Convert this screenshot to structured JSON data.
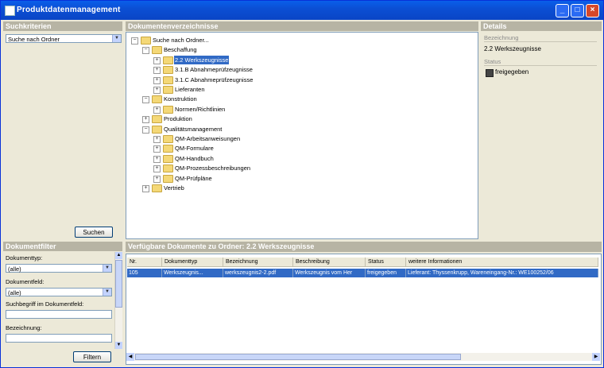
{
  "window": {
    "title": "Produktdatenmanagement"
  },
  "search_panel": {
    "header": "Suchkriterien",
    "combo_value": "Suche nach Ordner",
    "button": "Suchen"
  },
  "tree_panel": {
    "header": "Dokumentenverzeichnisse",
    "nodes": [
      {
        "label": "Suche nach Ordner...",
        "level": 0,
        "expanded": true
      },
      {
        "label": "Beschaffung",
        "level": 1,
        "expanded": true
      },
      {
        "label": "2.2 Werkszeugnisse",
        "level": 2,
        "expanded": false,
        "selected": true
      },
      {
        "label": "3.1.B Abnahmeprüfzeugnisse",
        "level": 2,
        "expanded": false
      },
      {
        "label": "3.1.C Abnahmeprüfzeugnisse",
        "level": 2,
        "expanded": false
      },
      {
        "label": "Lieferanten",
        "level": 2,
        "expanded": false
      },
      {
        "label": "Konstruktion",
        "level": 1,
        "expanded": true
      },
      {
        "label": "Normen/Richtlinien",
        "level": 2,
        "expanded": false
      },
      {
        "label": "Produktion",
        "level": 1,
        "expanded": false
      },
      {
        "label": "Qualitätsmanagement",
        "level": 1,
        "expanded": true
      },
      {
        "label": "QM-Arbeitsanweisungen",
        "level": 2,
        "expanded": false
      },
      {
        "label": "QM-Formulare",
        "level": 2,
        "expanded": false
      },
      {
        "label": "QM-Handbuch",
        "level": 2,
        "expanded": false
      },
      {
        "label": "QM-Prozessbeschreibungen",
        "level": 2,
        "expanded": false
      },
      {
        "label": "QM-Prüfpläne",
        "level": 2,
        "expanded": false
      },
      {
        "label": "Vertrieb",
        "level": 1,
        "expanded": false
      }
    ]
  },
  "details_panel": {
    "header": "Details",
    "bezeichnung_label": "Bezeichnung",
    "bezeichnung_value": "2.2 Werkszeugnisse",
    "status_label": "Status",
    "status_value": "freigegeben"
  },
  "filter_panel": {
    "header": "Dokumentfilter",
    "doctype_label": "Dokumenttyp:",
    "doctype_value": "(alle)",
    "field_label": "Dokumentfeld:",
    "field_value": "(alle)",
    "term_label": "Suchbegriff im Dokumentfeld:",
    "term_value": "",
    "name_label": "Bezeichnung:",
    "name_value": "",
    "button": "Filtern"
  },
  "documents_panel": {
    "header": "Verfügbare Dokumente zu Ordner: 2.2 Werkszeugnisse",
    "columns": [
      "Nr.",
      "Dokumenttyp",
      "Bezeichnung",
      "Beschreibung",
      "Status",
      "weitere Informationen"
    ],
    "rows": [
      [
        "105",
        "Werkszeugnis...",
        "werkszeugnis2-2.pdf",
        "Werkszeugnis vom Her",
        "freigegeben",
        "Lieferant: Thyssenkrupp, Wareneingang-Nr.: WE100252/06"
      ]
    ]
  },
  "colors": {
    "selection": "#316ac5",
    "panel_header": "#b7b4a4",
    "titlebar": "#0b4fd4"
  }
}
